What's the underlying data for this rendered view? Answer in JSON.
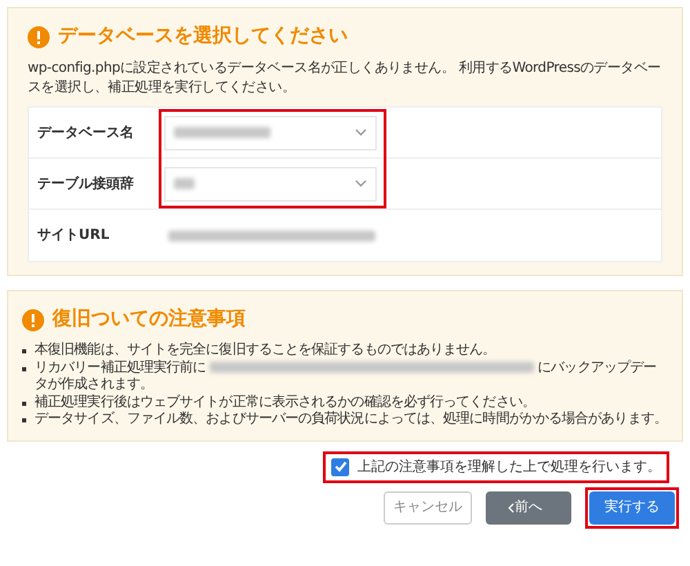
{
  "db_card": {
    "title": "データベースを選択してください",
    "description": "wp-config.phpに設定されているデータベース名が正しくありません。 利用するWordPressのデータベースを選択し、補正処理を実行してください。",
    "fields": [
      {
        "kind": "select",
        "label": "データベース名"
      },
      {
        "kind": "select",
        "label": "テーブル接頭辞"
      },
      {
        "kind": "text",
        "label": "サイトURL"
      }
    ]
  },
  "notes_card": {
    "title": "復旧ついての注意事項",
    "items": [
      {
        "parts": [
          "本復旧機能は、サイトを完全に復旧することを保証するものではありません。"
        ]
      },
      {
        "parts": [
          "リカバリー補正処理実行前に",
          "にバックアップデータが作成されます。"
        ]
      },
      {
        "parts": [
          "補正処理実行後はウェブサイトが正常に表示されるかの確認を必ず行ってください。"
        ]
      },
      {
        "parts": [
          "データサイズ、ファイル数、およびサーバーの負荷状況によっては、処理に時間がかかる場合があります。"
        ]
      }
    ]
  },
  "agree": {
    "label": "上記の注意事項を理解した上で処理を行います。",
    "checked": true
  },
  "buttons": [
    {
      "kind": "secondary",
      "label": "キャンセル"
    },
    {
      "kind": "back",
      "label": "前へ"
    },
    {
      "kind": "primary",
      "label": "実行する"
    }
  ]
}
